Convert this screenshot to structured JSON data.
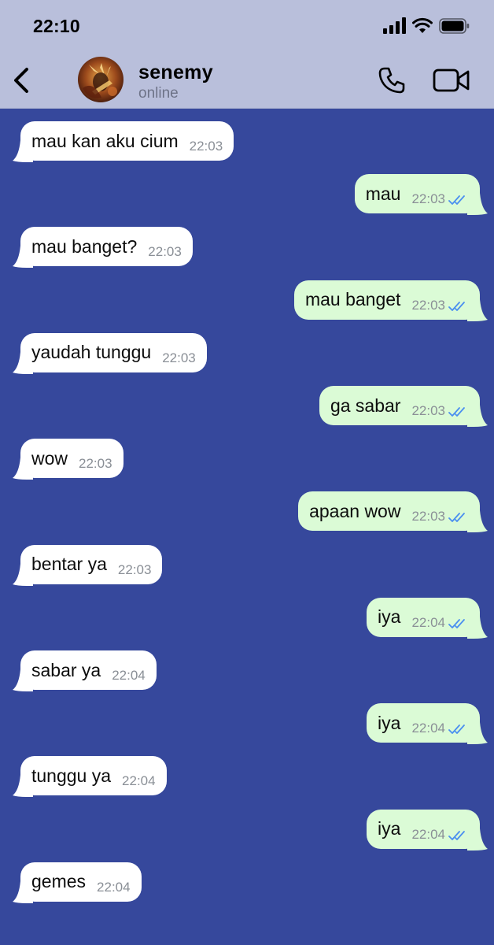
{
  "status_bar": {
    "time": "22:10"
  },
  "header": {
    "contact_name": "senemy",
    "contact_status": "online"
  },
  "colors": {
    "incoming_bubble": "#ffffff",
    "outgoing_bubble": "#dbfbd6",
    "chat_background": "#36489c",
    "read_ticks": "#4a8ff0"
  },
  "messages": [
    {
      "dir": "in",
      "text": "mau kan aku cium",
      "time": "22:03"
    },
    {
      "dir": "out",
      "text": "mau",
      "time": "22:03",
      "status": "read"
    },
    {
      "dir": "in",
      "text": "mau banget?",
      "time": "22:03"
    },
    {
      "dir": "out",
      "text": "mau banget",
      "time": "22:03",
      "status": "read"
    },
    {
      "dir": "in",
      "text": "yaudah tunggu",
      "time": "22:03"
    },
    {
      "dir": "out",
      "text": "ga sabar",
      "time": "22:03",
      "status": "read"
    },
    {
      "dir": "in",
      "text": "wow",
      "time": "22:03"
    },
    {
      "dir": "out",
      "text": "apaan wow",
      "time": "22:03",
      "status": "read"
    },
    {
      "dir": "in",
      "text": "bentar ya",
      "time": "22:03"
    },
    {
      "dir": "out",
      "text": "iya",
      "time": "22:04",
      "status": "read"
    },
    {
      "dir": "in",
      "text": "sabar ya",
      "time": "22:04"
    },
    {
      "dir": "out",
      "text": "iya",
      "time": "22:04",
      "status": "read"
    },
    {
      "dir": "in",
      "text": "tunggu ya",
      "time": "22:04"
    },
    {
      "dir": "out",
      "text": "iya",
      "time": "22:04",
      "status": "read"
    },
    {
      "dir": "in",
      "text": "gemes",
      "time": "22:04"
    }
  ]
}
